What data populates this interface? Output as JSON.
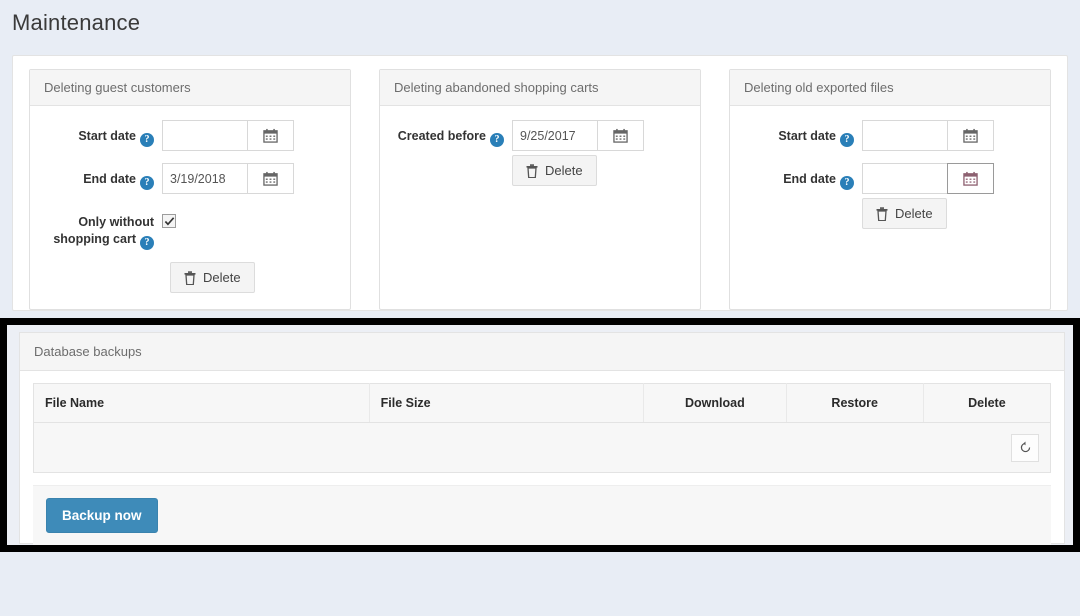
{
  "page": {
    "title": "Maintenance"
  },
  "panels": [
    {
      "title": "Deleting guest customers",
      "rows": [
        {
          "label": "Start date",
          "help": "?",
          "value": "",
          "icon": "calendar-icon"
        },
        {
          "label": "End date",
          "help": "?",
          "value": "3/19/2018",
          "icon": "calendar-icon"
        }
      ],
      "checkbox": {
        "label": "Only without shopping cart",
        "help": "?",
        "checked": true
      },
      "delete_button": {
        "label": "Delete",
        "icon": "trash-icon"
      }
    },
    {
      "title": "Deleting abandoned shopping carts",
      "rows": [
        {
          "label": "Created before",
          "help": "?",
          "value": "9/25/2017",
          "icon": "calendar-icon"
        }
      ],
      "delete_button": {
        "label": "Delete",
        "icon": "trash-icon"
      }
    },
    {
      "title": "Deleting old exported files",
      "rows": [
        {
          "label": "Start date",
          "help": "?",
          "value": "",
          "icon": "calendar-icon"
        },
        {
          "label": "End date",
          "help": "?",
          "value": "",
          "icon": "calendar-icon"
        }
      ],
      "delete_button": {
        "label": "Delete",
        "icon": "trash-icon"
      }
    }
  ],
  "backups": {
    "title": "Database backups",
    "columns": [
      "File Name",
      "File Size",
      "Download",
      "Restore",
      "Delete"
    ],
    "rows": [],
    "refresh_icon": "refresh-icon",
    "backup_button": "Backup now"
  },
  "colors": {
    "accent": "#3e8bb9",
    "help_icon": "#2a7fb8",
    "page_background": "#e8edf5",
    "highlight_border": "#000000"
  }
}
